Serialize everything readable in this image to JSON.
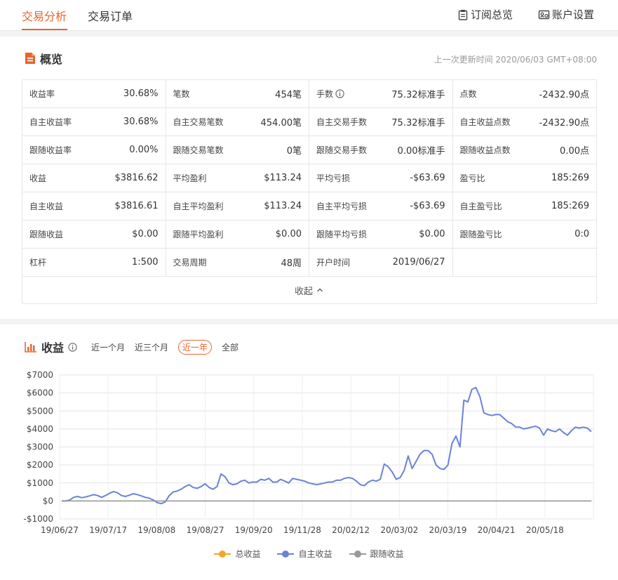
{
  "topbar": {
    "tabs": [
      "交易分析",
      "交易订单"
    ],
    "subscribe_overview": "订阅总览",
    "account_settings": "账户设置"
  },
  "overview": {
    "title": "概览",
    "update_time": "上一次更新时间 2020/06/03 GMT+08:00",
    "rows": [
      [
        [
          "收益率",
          "30.68%"
        ],
        [
          "笔数",
          "454笔"
        ],
        [
          "手数",
          "75.32标准手"
        ],
        [
          "点数",
          "-2432.90点"
        ]
      ],
      [
        [
          "自主收益率",
          "30.68%"
        ],
        [
          "自主交易笔数",
          "454.00笔"
        ],
        [
          "自主交易手数",
          "75.32标准手"
        ],
        [
          "自主收益点数",
          "-2432.90点"
        ]
      ],
      [
        [
          "跟随收益率",
          "0.00%"
        ],
        [
          "跟随交易笔数",
          "0笔"
        ],
        [
          "跟随交易手数",
          "0.00标准手"
        ],
        [
          "跟随收益点数",
          "0.00点"
        ]
      ],
      [
        [
          "收益",
          "$3816.62"
        ],
        [
          "平均盈利",
          "$113.24"
        ],
        [
          "平均亏损",
          "-$63.69"
        ],
        [
          "盈亏比",
          "185:269"
        ]
      ],
      [
        [
          "自主收益",
          "$3816.61"
        ],
        [
          "自主平均盈利",
          "$113.24"
        ],
        [
          "自主平均亏损",
          "-$63.69"
        ],
        [
          "自主盈亏比",
          "185:269"
        ]
      ],
      [
        [
          "跟随收益",
          "$0.00"
        ],
        [
          "跟随平均盈利",
          "$0.00"
        ],
        [
          "跟随平均亏损",
          "$0.00"
        ],
        [
          "跟随盈亏比",
          "0:0"
        ]
      ],
      [
        [
          "杠杆",
          "1:500"
        ],
        [
          "交易周期",
          "48周"
        ],
        [
          "开户时间",
          "2019/06/27"
        ],
        [
          "",
          ""
        ]
      ]
    ],
    "collapse_label": "收起"
  },
  "income": {
    "title": "收益",
    "periods": [
      "近一个月",
      "近三个月",
      "近一年",
      "全部"
    ],
    "active_period": "近一年",
    "legend": [
      {
        "name": "总收益",
        "color": "#f5a623"
      },
      {
        "name": "自主收益",
        "color": "#6a82d8"
      },
      {
        "name": "跟随收益",
        "color": "#999999"
      }
    ]
  },
  "colors": {
    "accent": "#e8662c",
    "line": "#6a82d8",
    "zero_line": "#999999"
  },
  "chart_data": {
    "type": "line",
    "x_ticks": [
      "19/06/27",
      "19/07/17",
      "19/08/08",
      "19/08/27",
      "19/09/20",
      "19/11/28",
      "20/02/12",
      "20/03/02",
      "20/03/19",
      "20/04/21",
      "20/05/18"
    ],
    "y_ticks": [
      "$7000",
      "$6000",
      "$5000",
      "$4000",
      "$3000",
      "$2000",
      "$1000",
      "$0",
      "-$1000"
    ],
    "ylim": [
      -1000,
      7000
    ],
    "grid": true,
    "legend_position": "bottom",
    "series": [
      {
        "name": "自主收益",
        "values": [
          0,
          0,
          50,
          200,
          250,
          180,
          220,
          280,
          350,
          300,
          200,
          300,
          420,
          520,
          450,
          300,
          250,
          320,
          400,
          350,
          280,
          200,
          150,
          50,
          -100,
          -150,
          -50,
          300,
          500,
          550,
          650,
          800,
          900,
          750,
          700,
          800,
          950,
          750,
          650,
          800,
          1500,
          1350,
          1000,
          900,
          950,
          1100,
          1150,
          1000,
          1050,
          1050,
          1200,
          1150,
          1250,
          1050,
          1050,
          1200,
          1100,
          1000,
          1250,
          1200,
          1150,
          1100,
          1000,
          950,
          900,
          950,
          1000,
          1050,
          1050,
          1150,
          1150,
          1250,
          1300,
          1250,
          1100,
          900,
          850,
          1050,
          1150,
          1100,
          1200,
          2050,
          1900,
          1600,
          1200,
          1300,
          1700,
          2500,
          1800,
          2200,
          2600,
          2800,
          2800,
          2600,
          2000,
          1800,
          1750,
          2000,
          3200,
          3600,
          3000,
          5600,
          5500,
          6200,
          6300,
          5800,
          4900,
          4800,
          4750,
          4800,
          4800,
          4600,
          4400,
          4300,
          4100,
          4100,
          4000,
          4050,
          4100,
          4150,
          4050,
          3650,
          4000,
          3900,
          3850,
          4000,
          3800,
          3650,
          3900,
          4100,
          4050,
          4100,
          4050,
          3850
        ]
      },
      {
        "name": "跟随收益",
        "values": [
          0,
          0
        ]
      }
    ]
  }
}
